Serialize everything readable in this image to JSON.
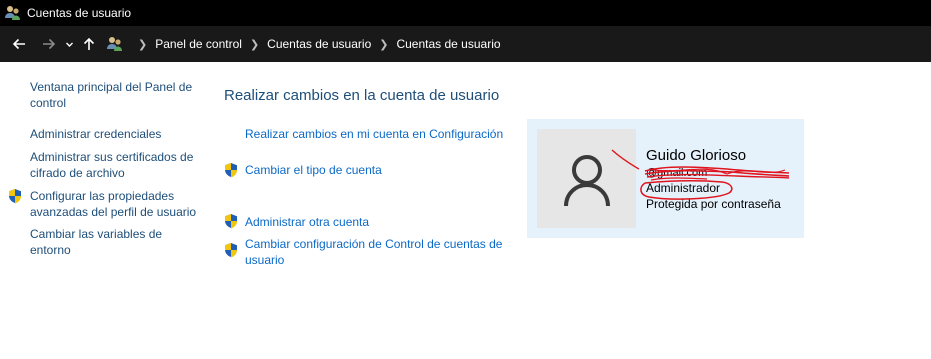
{
  "window": {
    "title": "Cuentas de usuario"
  },
  "breadcrumb": [
    "Panel de control",
    "Cuentas de usuario",
    "Cuentas de usuario"
  ],
  "left_pane": {
    "items": [
      {
        "label": "Ventana principal del Panel de control",
        "shield": false
      },
      {
        "label": "Administrar credenciales",
        "shield": false
      },
      {
        "label": "Administrar sus certificados de cifrado de archivo",
        "shield": false
      },
      {
        "label": "Configurar las propiedades avanzadas del perfil de usuario",
        "shield": true
      },
      {
        "label": "Cambiar las variables de entorno",
        "shield": false
      }
    ]
  },
  "main": {
    "title": "Realizar cambios en la cuenta de usuario",
    "tasks": [
      {
        "label": "Realizar cambios en mi cuenta en Configuración",
        "shield": false
      },
      {
        "label": "Cambiar el tipo de cuenta",
        "shield": true
      },
      {
        "label": "Administrar otra cuenta",
        "shield": true
      },
      {
        "label": "Cambiar configuración de Control de cuentas de usuario",
        "shield": true
      }
    ]
  },
  "account": {
    "name": "Guido Glorioso",
    "email": "@gmail.com",
    "role": "Administrador",
    "protection": "Protegida por contraseña"
  },
  "colors": {
    "titlebar": "#000000",
    "navbar": "#191919",
    "link": "#0b6ac7",
    "left_link": "#1e4e79",
    "card_bg": "#e5f1fb",
    "avatar_bg": "#e6e6e6",
    "scribble": "#e0141e"
  },
  "icons": {
    "app": "user-accounts-icon",
    "back": "arrow-left-icon",
    "forward": "arrow-right-icon",
    "recent": "chevron-down-icon",
    "up": "arrow-up-icon",
    "shield": "uac-shield-icon",
    "avatar": "user-silhouette-icon"
  }
}
